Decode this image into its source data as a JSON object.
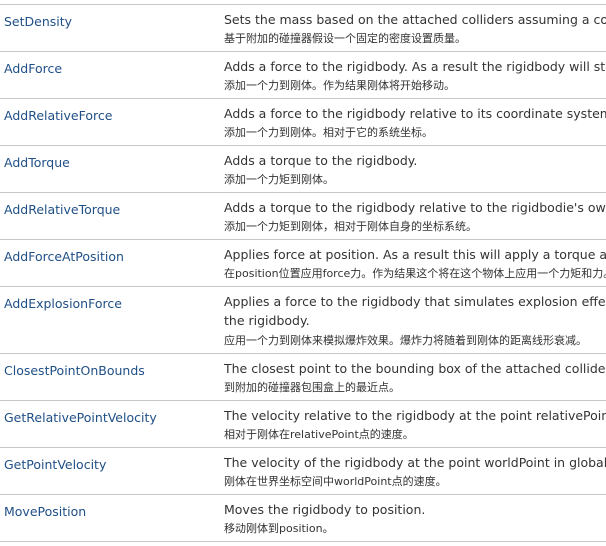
{
  "rows": [
    {
      "name": "SetDensity",
      "desc_en": "Sets the mass based on the attached colliders assuming a constant density.",
      "desc_zh": "基于附加的碰撞器假设一个固定的密度设置质量。"
    },
    {
      "name": "AddForce",
      "desc_en": "Adds a force to the rigidbody. As a result the rigidbody will start moving.",
      "desc_zh": "添加一个力到刚体。作为结果刚体将开始移动。"
    },
    {
      "name": "AddRelativeForce",
      "desc_en": "Adds a force to the rigidbody relative to its coordinate system.",
      "desc_zh": "添加一个力到刚体。相对于它的系统坐标。"
    },
    {
      "name": "AddTorque",
      "desc_en": "Adds a torque to the rigidbody.",
      "desc_zh": "添加一个力矩到刚体。"
    },
    {
      "name": "AddRelativeTorque",
      "desc_en": "Adds a torque to the rigidbody relative to the rigidbodie's own coordinate system.",
      "desc_zh": "添加一个力矩到刚体，相对于刚体自身的坐标系统。"
    },
    {
      "name": "AddForceAtPosition",
      "desc_en": "Applies force at position. As a result this will apply a torque and force on the object.",
      "desc_zh": "在position位置应用force力。作为结果这个将在这个物体上应用一个力矩和力。"
    },
    {
      "name": "AddExplosionForce",
      "desc_en": "Applies a force to the rigidbody that simulates explosion effects. The explosion force will fall off linearly with distance to",
      "desc_en2": "the rigidbody.",
      "desc_zh": "应用一个力到刚体来模拟爆炸效果。爆炸力将随着到刚体的距离线形衰减。"
    },
    {
      "name": "ClosestPointOnBounds",
      "desc_en": "The closest point to the bounding box of the attached colliders.",
      "desc_zh": "到附加的碰撞器包围盒上的最近点。"
    },
    {
      "name": "GetRelativePointVelocity",
      "desc_en": "The velocity relative to the rigidbody at the point relativePoint.",
      "desc_zh": "相对于刚体在relativePoint点的速度。"
    },
    {
      "name": "GetPointVelocity",
      "desc_en": "The velocity of the rigidbody at the point worldPoint in global space.",
      "desc_zh": "刚体在世界坐标空间中worldPoint点的速度。"
    },
    {
      "name": "MovePosition",
      "desc_en": "Moves the rigidbody to position.",
      "desc_zh": "移动刚体到position。"
    }
  ]
}
